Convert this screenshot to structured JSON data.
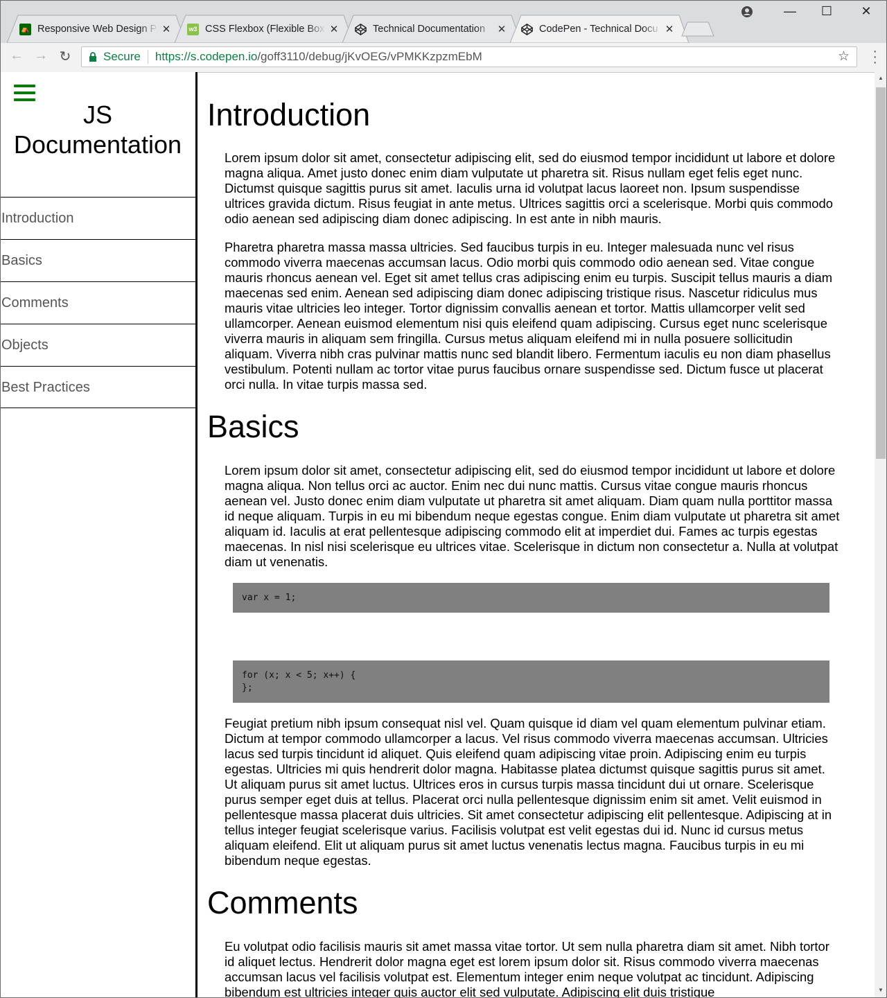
{
  "browser": {
    "tabs": [
      {
        "title": "Responsive Web Design P",
        "favicon": "fcc-icon",
        "close": "✕"
      },
      {
        "title": "CSS Flexbox (Flexible Box",
        "favicon": "w3-icon",
        "close": "✕"
      },
      {
        "title": "Technical Documentation",
        "favicon": "codepen-icon",
        "close": "✕"
      },
      {
        "title": "CodePen - Technical Docu",
        "favicon": "codepen-icon",
        "close": "✕"
      }
    ],
    "secure_label": "Secure",
    "url_host": "https://s.codepen.io",
    "url_path": "/goff3110/debug/jKvOEG/vPMKKzpzmEbM",
    "accent": "#0b8043"
  },
  "sidebar": {
    "title_line1": "JS",
    "title_line2": "Documentation",
    "menu_color": "#0a7a0a",
    "links": [
      "Introduction",
      "Basics",
      "Comments",
      "Objects",
      "Best Practices"
    ]
  },
  "sections": {
    "intro": {
      "heading": "Introduction",
      "p1": "Lorem ipsum dolor sit amet, consectetur adipiscing elit, sed do eiusmod tempor incididunt ut labore et dolore magna aliqua. Amet justo donec enim diam vulputate ut pharetra sit. Risus nullam eget felis eget nunc. Dictumst quisque sagittis purus sit amet. Iaculis urna id volutpat lacus laoreet non. Ipsum suspendisse ultrices gravida dictum. Risus feugiat in ante metus. Ultrices sagittis orci a scelerisque. Morbi quis commodo odio aenean sed adipiscing diam donec adipiscing. In est ante in nibh mauris.",
      "p2": "Pharetra pharetra massa massa ultricies. Sed faucibus turpis in eu. Integer malesuada nunc vel risus commodo viverra maecenas accumsan lacus. Odio morbi quis commodo odio aenean sed. Vitae congue mauris rhoncus aenean vel. Eget sit amet tellus cras adipiscing enim eu turpis. Suscipit tellus mauris a diam maecenas sed enim. Aenean sed adipiscing diam donec adipiscing tristique risus. Nascetur ridiculus mus mauris vitae ultricies leo integer. Tortor dignissim convallis aenean et tortor. Mattis ullamcorper velit sed ullamcorper. Aenean euismod elementum nisi quis eleifend quam adipiscing. Cursus eget nunc scelerisque viverra mauris in aliquam sem fringilla. Cursus metus aliquam eleifend mi in nulla posuere sollicitudin aliquam. Viverra nibh cras pulvinar mattis nunc sed blandit libero. Fermentum iaculis eu non diam phasellus vestibulum. Potenti nullam ac tortor vitae purus faucibus ornare suspendisse sed. Dictum fusce ut placerat orci nulla. In vitae turpis massa sed."
    },
    "basics": {
      "heading": "Basics",
      "p1": "Lorem ipsum dolor sit amet, consectetur adipiscing elit, sed do eiusmod tempor incididunt ut labore et dolore magna aliqua. Non tellus orci ac auctor. Enim nec dui nunc mattis. Cursus vitae congue mauris rhoncus aenean vel. Justo donec enim diam vulputate ut pharetra sit amet aliquam. Diam quam nulla porttitor massa id neque aliquam. Turpis in eu mi bibendum neque egestas congue. Enim diam vulputate ut pharetra sit amet aliquam id. Iaculis at erat pellentesque adipiscing commodo elit at imperdiet dui. Fames ac turpis egestas maecenas. In nisl nisi scelerisque eu ultrices vitae. Scelerisque in dictum non consectetur a. Nulla at volutpat diam ut venenatis.",
      "code1": "var x = 1;",
      "code2": "for (x; x < 5; x++) {\n};",
      "p2": "Feugiat pretium nibh ipsum consequat nisl vel. Quam quisque id diam vel quam elementum pulvinar etiam. Dictum at tempor commodo ullamcorper a lacus. Vel risus commodo viverra maecenas accumsan. Ultricies lacus sed turpis tincidunt id aliquet. Quis eleifend quam adipiscing vitae proin. Adipiscing enim eu turpis egestas. Ultricies mi quis hendrerit dolor magna. Habitasse platea dictumst quisque sagittis purus sit amet. Ut aliquam purus sit amet luctus. Ultrices eros in cursus turpis massa tincidunt dui ut ornare. Scelerisque purus semper eget duis at tellus. Placerat orci nulla pellentesque dignissim enim sit amet. Velit euismod in pellentesque massa placerat duis ultricies. Sit amet consectetur adipiscing elit pellentesque. Adipiscing at in tellus integer feugiat scelerisque varius. Facilisis volutpat est velit egestas dui id. Nunc id cursus metus aliquam eleifend. Elit ut aliquam purus sit amet luctus venenatis lectus magna. Faucibus turpis in eu mi bibendum neque egestas."
    },
    "comments": {
      "heading": "Comments",
      "p1": "Eu volutpat odio facilisis mauris sit amet massa vitae tortor. Ut sem nulla pharetra diam sit amet. Nibh tortor id aliquet lectus. Hendrerit dolor magna eget est lorem ipsum dolor sit. Risus commodo viverra maecenas accumsan lacus vel facilisis volutpat est. Elementum integer enim neque volutpat ac tincidunt. Adipiscing bibendum est ultricies integer quis auctor elit sed vulputate. Adipiscing elit duis tristique"
    }
  }
}
